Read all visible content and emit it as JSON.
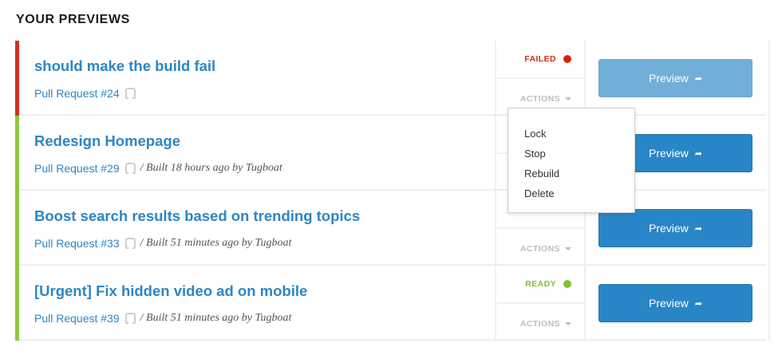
{
  "heading": "YOUR PREVIEWS",
  "previews": [
    {
      "title": "should make the build fail",
      "pull_request": "Pull Request #24",
      "built": "",
      "status": "FAILED",
      "actions_label": "ACTIONS",
      "button_label": "Preview"
    },
    {
      "title": "Redesign Homepage",
      "pull_request": "Pull Request #29",
      "built": "/ Built 18 hours ago by Tugboat",
      "status": "",
      "actions_label": "",
      "button_label": "Preview"
    },
    {
      "title": "Boost search results based on trending topics",
      "pull_request": "Pull Request #33",
      "built": "/ Built 51 minutes ago by Tugboat",
      "status": "",
      "actions_label": "ACTIONS",
      "button_label": "Preview"
    },
    {
      "title": "[Urgent] Fix hidden video ad on mobile",
      "pull_request": "Pull Request #39",
      "built": "/ Built 51 minutes ago by Tugboat",
      "status": "READY",
      "actions_label": "ACTIONS",
      "button_label": "Preview"
    }
  ],
  "actions_menu": {
    "items": [
      "Lock",
      "Stop",
      "Rebuild",
      "Delete"
    ]
  },
  "colors": {
    "failed": "#d91e0f",
    "ready": "#7dc232",
    "link": "#2d86c5",
    "button": "#2986c6"
  },
  "icons": {
    "repo": "github-icon",
    "button_arrow": "share-arrow-icon",
    "actions": "caret-down-icon"
  }
}
